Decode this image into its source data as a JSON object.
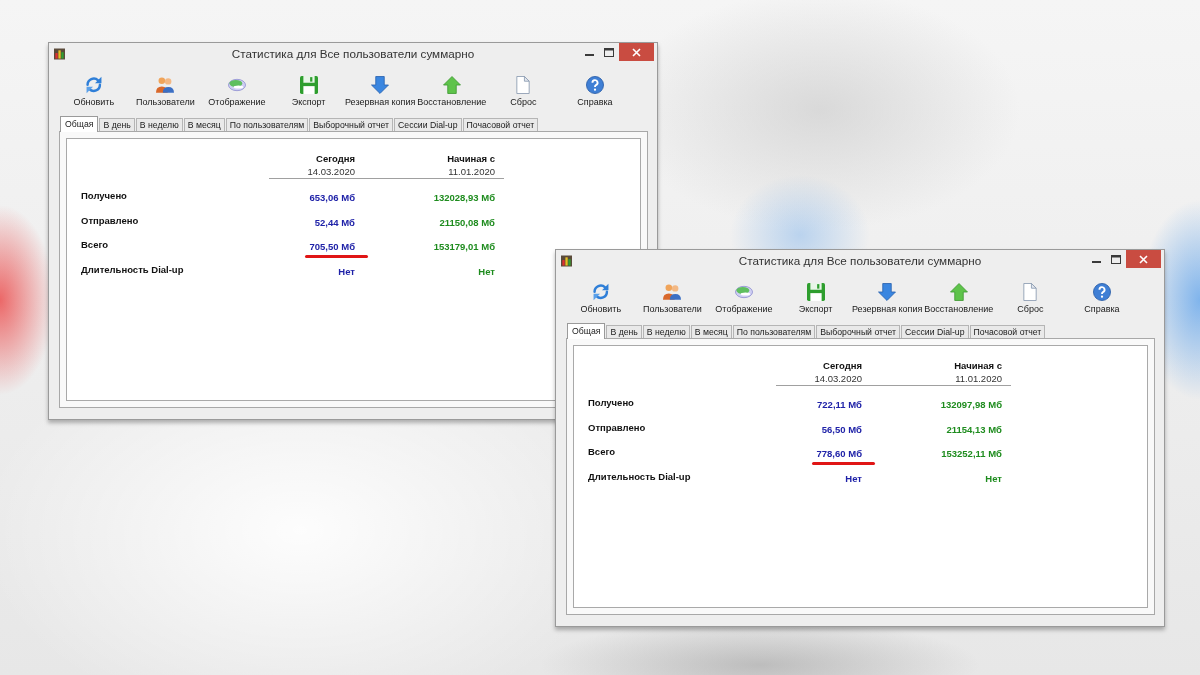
{
  "windows": [
    {
      "title": "Статистика для Все пользователи суммарно",
      "toolbar": [
        {
          "kind": "refresh",
          "label": "Обновить"
        },
        {
          "kind": "users",
          "label": "Пользователи"
        },
        {
          "kind": "view",
          "label": "Отображение"
        },
        {
          "kind": "export",
          "label": "Экспорт"
        },
        {
          "kind": "backup",
          "label": "Резервная копия"
        },
        {
          "kind": "restore",
          "label": "Восстановление"
        },
        {
          "kind": "reset",
          "label": "Сброс"
        },
        {
          "kind": "help",
          "label": "Справка"
        }
      ],
      "tabs": [
        {
          "label": "Общая",
          "selected": true
        },
        {
          "label": "В день",
          "selected": false
        },
        {
          "label": "В неделю",
          "selected": false
        },
        {
          "label": "В месяц",
          "selected": false
        },
        {
          "label": "По пользователям",
          "selected": false
        },
        {
          "label": "Выборочный отчет",
          "selected": false
        },
        {
          "label": "Сессии Dial-up",
          "selected": false
        },
        {
          "label": "Почасовой отчет",
          "selected": false
        }
      ],
      "table": {
        "columns": [
          {
            "title": "Сегодня",
            "date": "14.03.2020"
          },
          {
            "title": "Начиная с",
            "date": "11.01.2020"
          }
        ],
        "rows": [
          {
            "label": "Получено",
            "cells": [
              {
                "text": "653,06 Мб",
                "underlined": false
              },
              {
                "text": "132028,93 Мб",
                "underlined": false
              }
            ]
          },
          {
            "label": "Отправлено",
            "cells": [
              {
                "text": "52,44 Мб",
                "underlined": false
              },
              {
                "text": "21150,08 Мб",
                "underlined": false
              }
            ]
          },
          {
            "label": "Всего",
            "cells": [
              {
                "text": "705,50 Мб",
                "underlined": true
              },
              {
                "text": "153179,01 Мб",
                "underlined": false
              }
            ]
          },
          {
            "label": "Длительность Dial-up",
            "cells": [
              {
                "text": "Нет",
                "underlined": false
              },
              {
                "text": "Нет",
                "underlined": false
              }
            ]
          }
        ]
      }
    },
    {
      "title": "Статистика для Все пользователи суммарно",
      "toolbar": [
        {
          "kind": "refresh",
          "label": "Обновить"
        },
        {
          "kind": "users",
          "label": "Пользователи"
        },
        {
          "kind": "view",
          "label": "Отображение"
        },
        {
          "kind": "export",
          "label": "Экспорт"
        },
        {
          "kind": "backup",
          "label": "Резервная копия"
        },
        {
          "kind": "restore",
          "label": "Восстановление"
        },
        {
          "kind": "reset",
          "label": "Сброс"
        },
        {
          "kind": "help",
          "label": "Справка"
        }
      ],
      "tabs": [
        {
          "label": "Общая",
          "selected": true
        },
        {
          "label": "В день",
          "selected": false
        },
        {
          "label": "В неделю",
          "selected": false
        },
        {
          "label": "В месяц",
          "selected": false
        },
        {
          "label": "По пользователям",
          "selected": false
        },
        {
          "label": "Выборочный отчет",
          "selected": false
        },
        {
          "label": "Сессии Dial-up",
          "selected": false
        },
        {
          "label": "Почасовой отчет",
          "selected": false
        }
      ],
      "table": {
        "columns": [
          {
            "title": "Сегодня",
            "date": "14.03.2020"
          },
          {
            "title": "Начиная с",
            "date": "11.01.2020"
          }
        ],
        "rows": [
          {
            "label": "Получено",
            "cells": [
              {
                "text": "722,11 Мб",
                "underlined": false
              },
              {
                "text": "132097,98 Мб",
                "underlined": false
              }
            ]
          },
          {
            "label": "Отправлено",
            "cells": [
              {
                "text": "56,50 Мб",
                "underlined": false
              },
              {
                "text": "21154,13 Мб",
                "underlined": false
              }
            ]
          },
          {
            "label": "Всего",
            "cells": [
              {
                "text": "778,60 Мб",
                "underlined": true
              },
              {
                "text": "153252,11 Мб",
                "underlined": false
              }
            ]
          },
          {
            "label": "Длительность Dial-up",
            "cells": [
              {
                "text": "Нет",
                "underlined": false
              },
              {
                "text": "Нет",
                "underlined": false
              }
            ]
          }
        ]
      }
    }
  ]
}
